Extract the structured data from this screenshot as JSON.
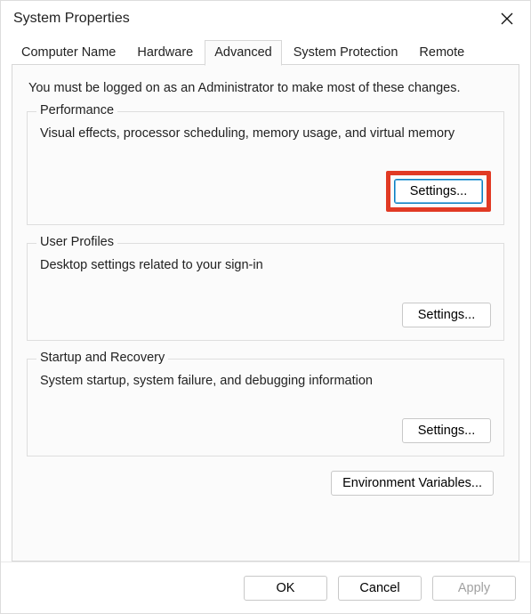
{
  "window": {
    "title": "System Properties"
  },
  "tabs": {
    "computer_name": "Computer Name",
    "hardware": "Hardware",
    "advanced": "Advanced",
    "system_protection": "System Protection",
    "remote": "Remote",
    "active": "advanced"
  },
  "advanced_page": {
    "intro": "You must be logged on as an Administrator to make most of these changes.",
    "performance": {
      "legend": "Performance",
      "desc": "Visual effects, processor scheduling, memory usage, and virtual memory",
      "button": "Settings...",
      "highlighted": true
    },
    "user_profiles": {
      "legend": "User Profiles",
      "desc": "Desktop settings related to your sign-in",
      "button": "Settings..."
    },
    "startup_recovery": {
      "legend": "Startup and Recovery",
      "desc": "System startup, system failure, and debugging information",
      "button": "Settings..."
    },
    "env_button": "Environment Variables..."
  },
  "footer": {
    "ok": "OK",
    "cancel": "Cancel",
    "apply": "Apply",
    "apply_enabled": false
  }
}
